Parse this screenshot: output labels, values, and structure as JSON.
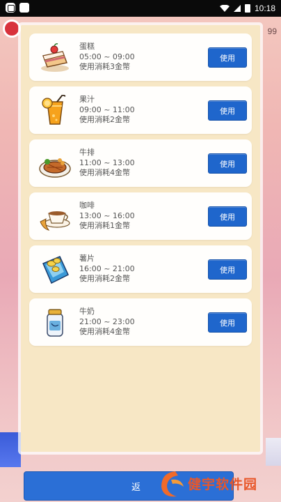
{
  "status_bar": {
    "time": "10:18",
    "icons": [
      "app-icon",
      "app-icon-square",
      "wifi-icon",
      "signal-icon",
      "battery-icon"
    ]
  },
  "background": {
    "right_number": "99"
  },
  "items": [
    {
      "name": "蛋糕",
      "time": "05:00 ~ 09:00",
      "cost": "使用消耗3金幣",
      "button": "使用",
      "icon": "cake-icon"
    },
    {
      "name": "果汁",
      "time": "09:00 ~ 11:00",
      "cost": "使用消耗2金幣",
      "button": "使用",
      "icon": "juice-icon"
    },
    {
      "name": "牛排",
      "time": "11:00 ~ 13:00",
      "cost": "使用消耗4金幣",
      "button": "使用",
      "icon": "steak-icon"
    },
    {
      "name": "咖啡",
      "time": "13:00 ~ 16:00",
      "cost": "使用消耗1金幣",
      "button": "使用",
      "icon": "coffee-icon"
    },
    {
      "name": "薯片",
      "time": "16:00 ~ 21:00",
      "cost": "使用消耗2金幣",
      "button": "使用",
      "icon": "chips-icon"
    },
    {
      "name": "牛奶",
      "time": "21:00 ~ 23:00",
      "cost": "使用消耗4金幣",
      "button": "使用",
      "icon": "milk-icon"
    }
  ],
  "footer": {
    "return_label": "返"
  },
  "watermark": {
    "text": "健宇软件园"
  },
  "colors": {
    "panel_bg": "#f7e7c5",
    "card_bg": "#fffefc",
    "button_blue": "#1f66cc",
    "watermark_orange": "#e8572a"
  }
}
